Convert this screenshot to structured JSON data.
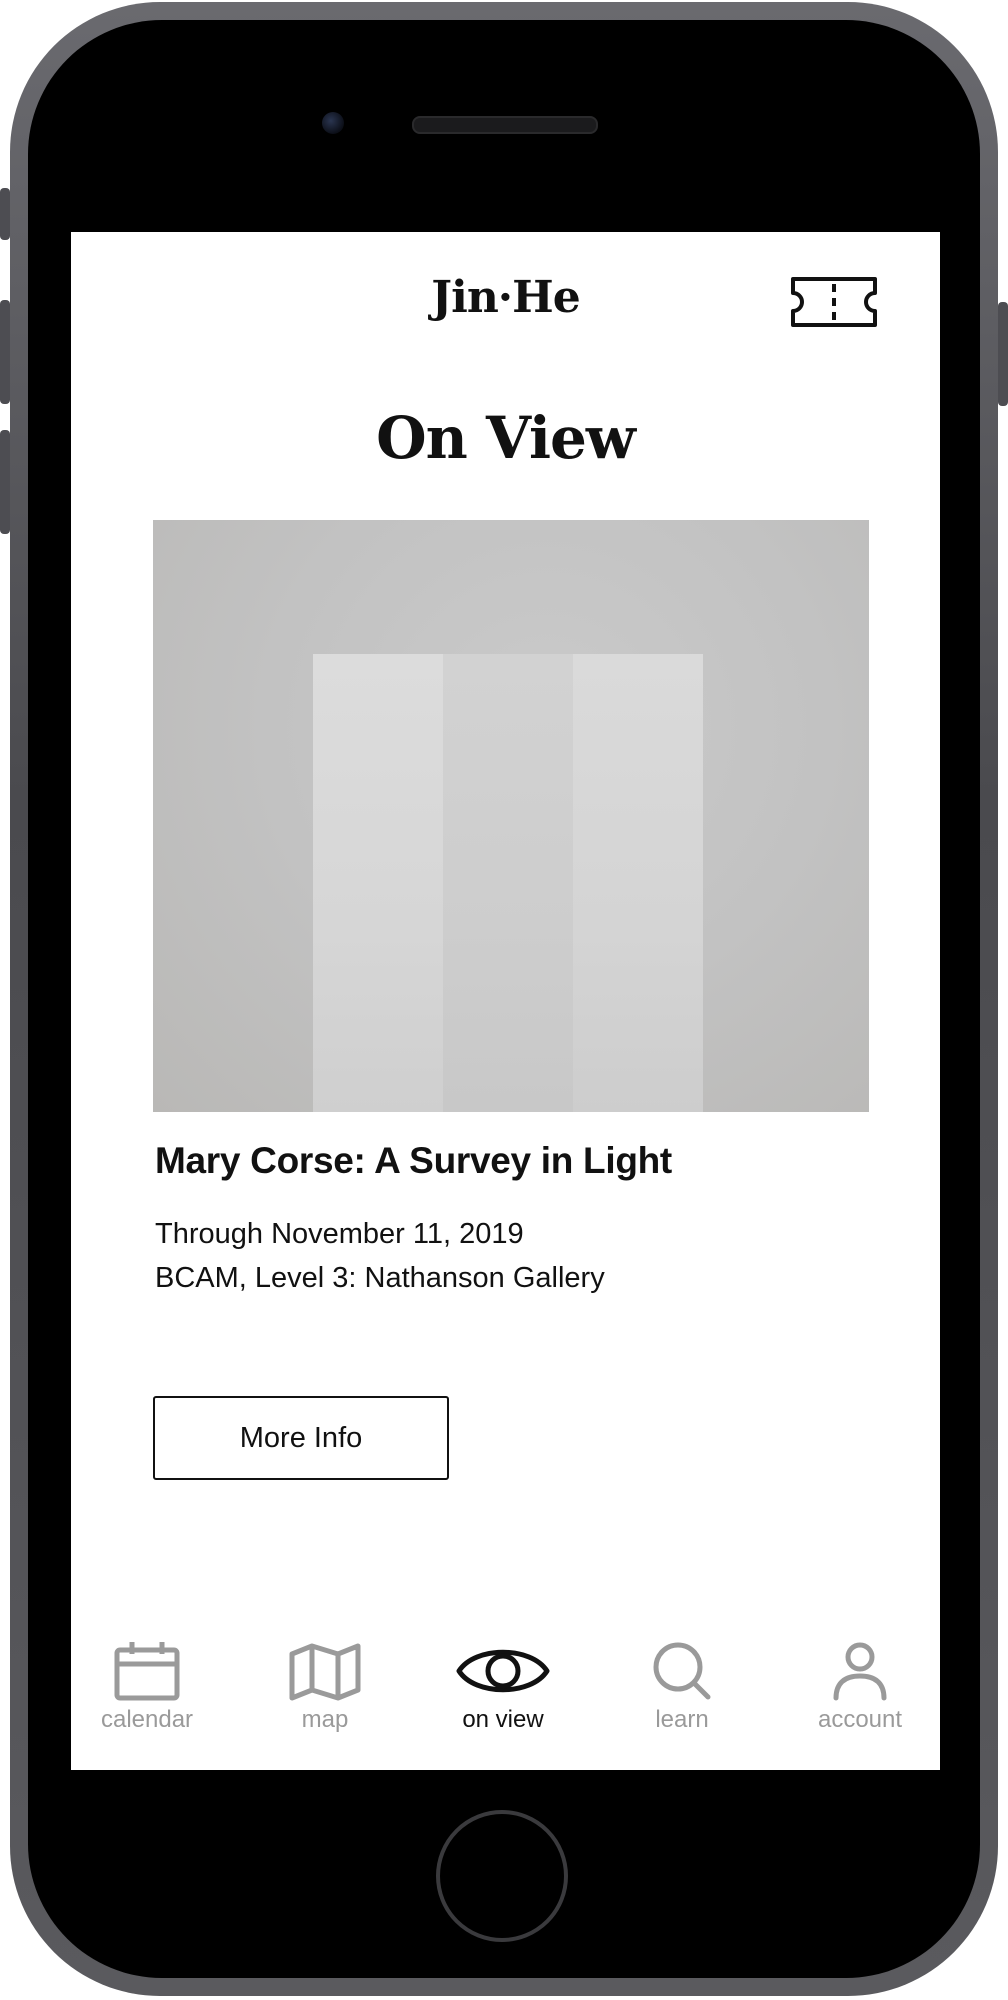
{
  "app": {
    "logo": "Jin·He"
  },
  "header": {
    "ticket_icon": "ticket-icon"
  },
  "page": {
    "title": "On View"
  },
  "exhibition": {
    "image": "artwork-image",
    "title": "Mary Corse: A Survey in Light",
    "dates": "Through November 11, 2019",
    "location": "BCAM, Level 3: Nathanson Gallery",
    "button_label": "More Info"
  },
  "nav": {
    "items": [
      {
        "label": "calendar",
        "icon": "calendar-icon",
        "active": false
      },
      {
        "label": "map",
        "icon": "map-icon",
        "active": false
      },
      {
        "label": "on view",
        "icon": "eye-icon",
        "active": true
      },
      {
        "label": "learn",
        "icon": "search-icon",
        "active": false
      },
      {
        "label": "account",
        "icon": "user-icon",
        "active": false
      }
    ]
  },
  "colors": {
    "text": "#111111",
    "inactive_nav": "#9a9a9a",
    "background": "#ffffff"
  }
}
